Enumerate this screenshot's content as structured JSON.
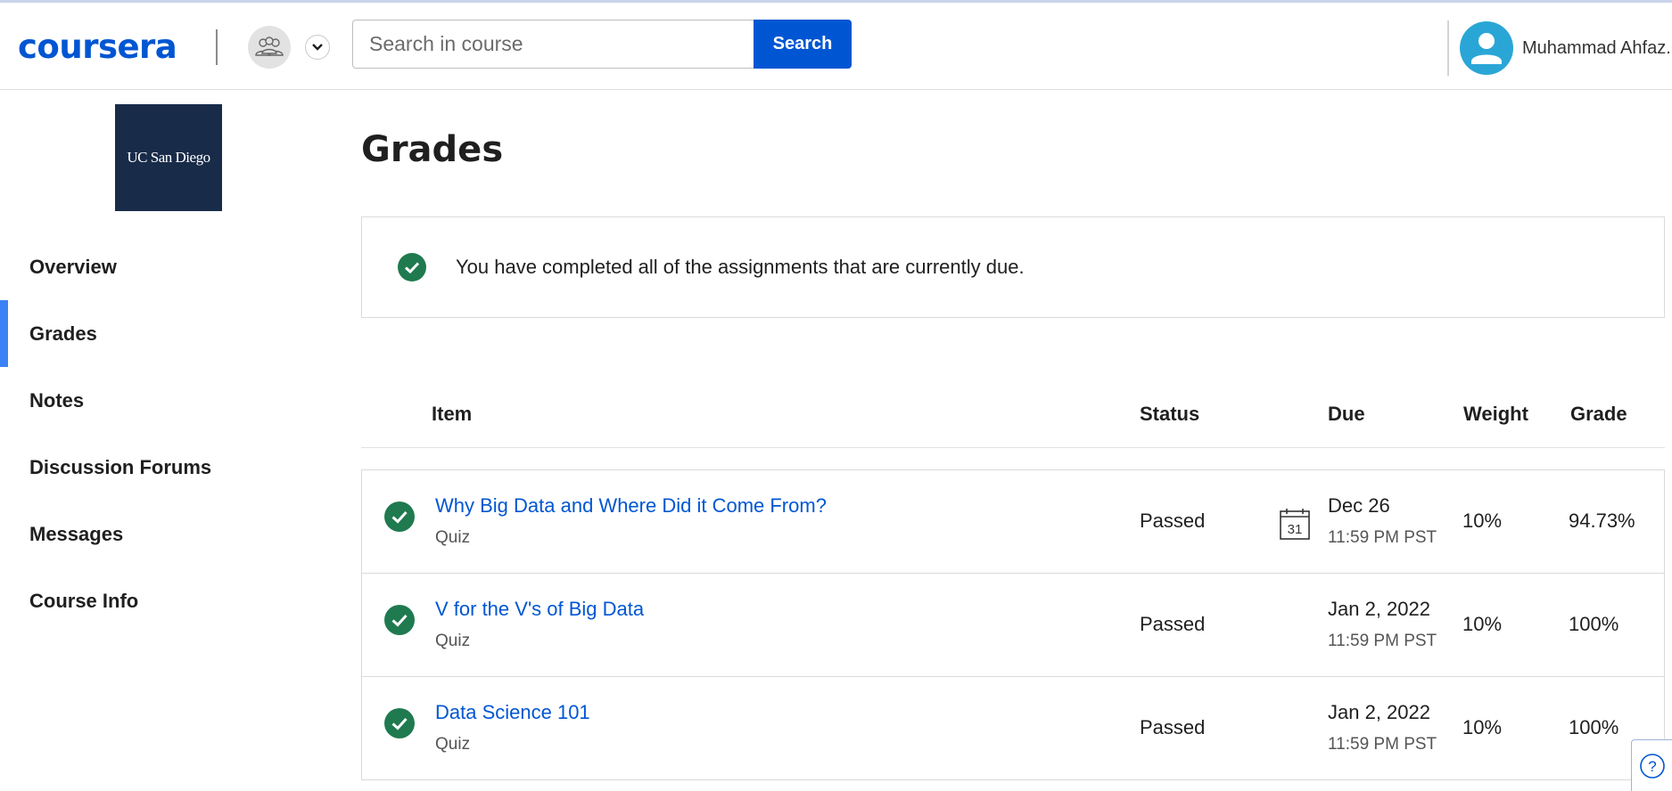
{
  "header": {
    "logo_text": "coursera",
    "search_placeholder": "Search in course",
    "search_button": "Search",
    "user_name": "Muhammad Ahfaz..."
  },
  "sidebar": {
    "university_logo_text": "UC San Diego",
    "items": [
      {
        "label": "Overview",
        "active": false
      },
      {
        "label": "Grades",
        "active": true
      },
      {
        "label": "Notes",
        "active": false
      },
      {
        "label": "Discussion Forums",
        "active": false
      },
      {
        "label": "Messages",
        "active": false
      },
      {
        "label": "Course Info",
        "active": false
      }
    ]
  },
  "main": {
    "title": "Grades",
    "banner_text": "You have completed all of the assignments that are currently due.",
    "columns": {
      "item": "Item",
      "status": "Status",
      "due": "Due",
      "weight": "Weight",
      "grade": "Grade"
    },
    "rows": [
      {
        "title": "Why Big Data and Where Did it Come From?",
        "type": "Quiz",
        "status": "Passed",
        "calendar_day": "31",
        "due_date": "Dec 26",
        "due_time": "11:59 PM PST",
        "weight": "10%",
        "grade": "94.73%"
      },
      {
        "title": "V for the V's of Big Data",
        "type": "Quiz",
        "status": "Passed",
        "due_date": "Jan 2, 2022",
        "due_time": "11:59 PM PST",
        "weight": "10%",
        "grade": "100%"
      },
      {
        "title": "Data Science 101",
        "type": "Quiz",
        "status": "Passed",
        "due_date": "Jan 2, 2022",
        "due_time": "11:59 PM PST",
        "weight": "10%",
        "grade": "100%"
      }
    ]
  },
  "help_label": "?",
  "colors": {
    "brand_blue": "#0056d2",
    "active_indicator": "#3b82f6",
    "success_green": "#1f7a4f",
    "uc_navy": "#182b49"
  }
}
